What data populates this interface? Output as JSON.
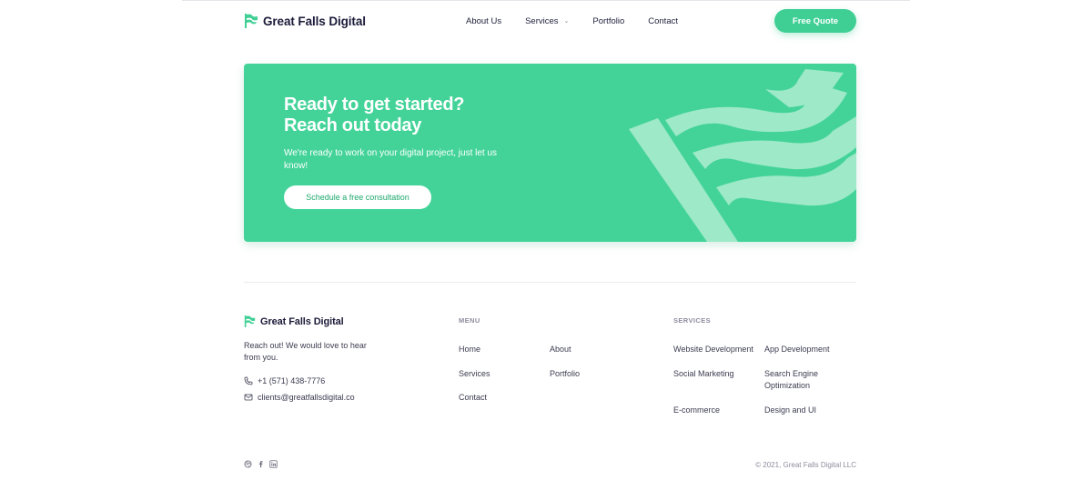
{
  "header": {
    "brand": "Great Falls Digital",
    "nav": [
      {
        "label": "About Us",
        "dropdown": false
      },
      {
        "label": "Services",
        "dropdown": true
      },
      {
        "label": "Portfolio",
        "dropdown": false
      },
      {
        "label": "Contact",
        "dropdown": false
      }
    ],
    "quote_button": "Free Quote"
  },
  "cta": {
    "title_line1": "Ready to get started?",
    "title_line2": "Reach out today",
    "subtitle": "We're ready to work on your digital project, just let us know!",
    "button": "Schedule a free consultation"
  },
  "footer": {
    "brand": "Great Falls Digital",
    "tagline": "Reach out! We would love to hear from you.",
    "phone": "+1 (571) 438-7776",
    "email": "clients@greatfallsdigital.co",
    "menu_heading": "MENU",
    "menu": [
      "Home",
      "About",
      "Services",
      "Portfolio",
      "Contact"
    ],
    "services_heading": "SERVICES",
    "services": [
      "Website Development",
      "App Development",
      "Social Marketing",
      "Search Engine Optimization",
      "E-commerce",
      "Design and UI"
    ],
    "social_icons": [
      "dribbble-icon",
      "facebook-icon",
      "linkedin-icon"
    ],
    "copyright": "© 2021, Great Falls Digital LLC"
  },
  "colors": {
    "accent": "#43d398",
    "accent_button": "#3fcf95",
    "brand_text": "#1b1b3a",
    "muted": "#8d8d9f"
  }
}
